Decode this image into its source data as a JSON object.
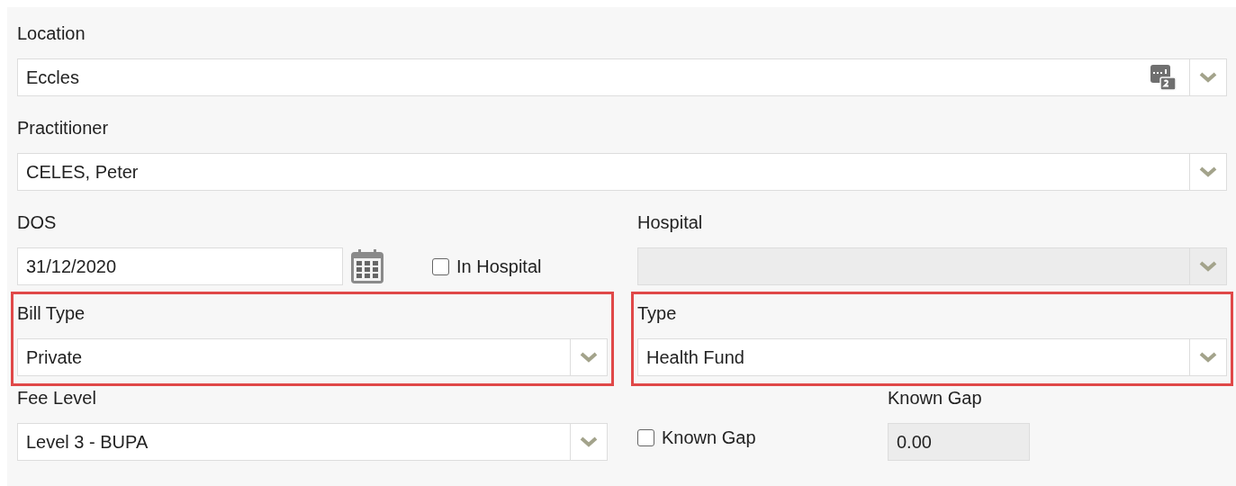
{
  "location": {
    "label": "Location",
    "value": "Eccles"
  },
  "practitioner": {
    "label": "Practitioner",
    "value": "CELES, Peter"
  },
  "dos": {
    "label": "DOS",
    "value": "31/12/2020"
  },
  "in_hospital": {
    "label": "In Hospital",
    "checked": false
  },
  "hospital": {
    "label": "Hospital",
    "disabled": true
  },
  "bill_type": {
    "label": "Bill Type",
    "value": "Private",
    "highlighted": true
  },
  "type": {
    "label": "Type",
    "value": "Health Fund",
    "highlighted": true
  },
  "fee_level": {
    "label": "Fee Level",
    "value": "Level 3 - BUPA"
  },
  "known_gap_check": {
    "label": "Known Gap",
    "checked": false
  },
  "known_gap": {
    "label": "Known Gap",
    "value": "0.00",
    "disabled": true
  }
}
